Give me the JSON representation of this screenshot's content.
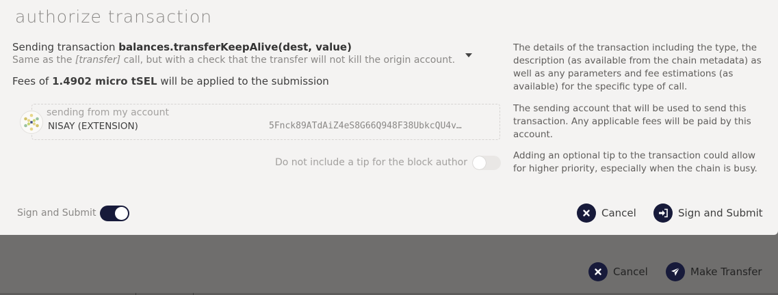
{
  "modal": {
    "title": "authorize transaction",
    "transaction": {
      "prefix": "Sending transaction ",
      "call": "balances.transferKeepAlive(dest, value)",
      "desc_before": "Same as the ",
      "desc_em": "[transfer]",
      "desc_after": " call, but with a check that the transfer will not kill the origin account."
    },
    "fees": {
      "prefix": "Fees of ",
      "amount": "1.4902 micro tSEL",
      "suffix": " will be applied to the submission"
    },
    "account": {
      "label": "sending from my account",
      "name": "NISAY (EXTENSION)",
      "address": "5Fnck89ATdAiZ4eS8G66Q948F38UbkcQU4v…"
    },
    "tip": {
      "label": "Do not include a tip for the block author",
      "enabled": false
    },
    "help": [
      "The details of the transaction including the type, the description (as available from the chain metadata) as well as any parameters and fee estimations (as available) for the specific type of call.",
      "The sending account that will be used to send this transaction. Any applicable fees will be paid by this account.",
      "Adding an optional tip to the transaction could allow for higher priority, especially when the chain is busy."
    ],
    "sign_toggle": {
      "label": "Sign and Submit",
      "enabled": true
    },
    "buttons": {
      "cancel": "Cancel",
      "submit": "Sign and Submit"
    }
  },
  "background": {
    "buttons": {
      "cancel": "Cancel",
      "make_transfer": "Make Transfer"
    }
  },
  "colors": {
    "accent": "#171a3a",
    "modal_bg": "#f4f3f2",
    "overlay": "#6f6e6d"
  }
}
